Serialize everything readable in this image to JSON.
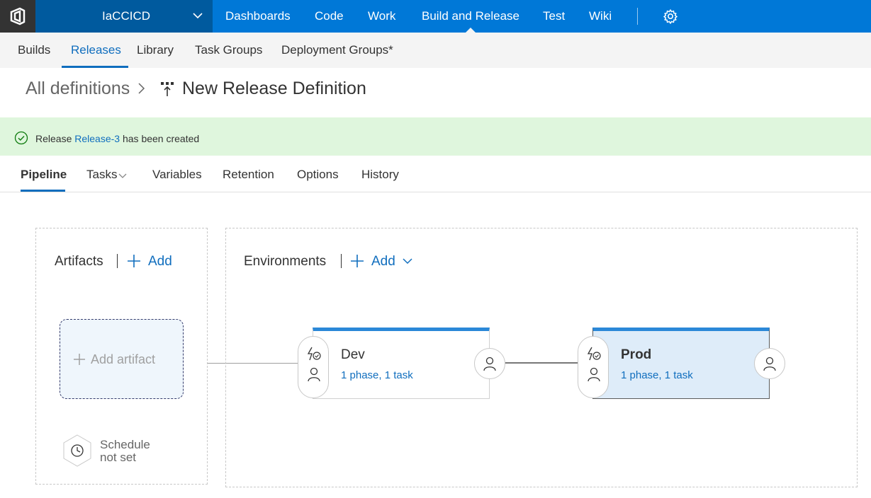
{
  "topbar": {
    "project_name": "IaCCICD",
    "nav_items": [
      "Dashboards",
      "Code",
      "Work",
      "Build and Release",
      "Test",
      "Wiki"
    ],
    "active_item": "Build and Release",
    "colors": {
      "bar": "#0078d7",
      "project_bg": "#005a9e",
      "logo_bg": "#333333"
    }
  },
  "subnav": {
    "tabs": [
      "Builds",
      "Releases",
      "Library",
      "Task Groups",
      "Deployment Groups*"
    ],
    "active_tab": "Releases"
  },
  "breadcrumb": {
    "parent": "All definitions",
    "title": "New Release Definition"
  },
  "banner": {
    "prefix": "Release",
    "link_text": "Release-3",
    "suffix": "has been created",
    "color": "#dff6dd"
  },
  "pipeline_tabs": {
    "tabs": [
      "Pipeline",
      "Tasks",
      "Variables",
      "Retention",
      "Options",
      "History"
    ],
    "active_tab": "Pipeline"
  },
  "artifacts": {
    "title": "Artifacts",
    "add_label": "Add",
    "add_artifact_label": "Add artifact",
    "schedule_line1": "Schedule",
    "schedule_line2": "not set"
  },
  "environments": {
    "title": "Environments",
    "add_label": "Add",
    "items": [
      {
        "name": "Dev",
        "summary": "1 phase, 1 task",
        "selected": false
      },
      {
        "name": "Prod",
        "summary": "1 phase, 1 task",
        "selected": true
      }
    ]
  },
  "icons": [
    "logo-icon",
    "chevron-down-icon",
    "gear-icon",
    "chevron-right-icon",
    "release-definition-icon",
    "check-circle-icon",
    "plus-icon",
    "clock-icon",
    "trigger-icon",
    "person-icon"
  ]
}
